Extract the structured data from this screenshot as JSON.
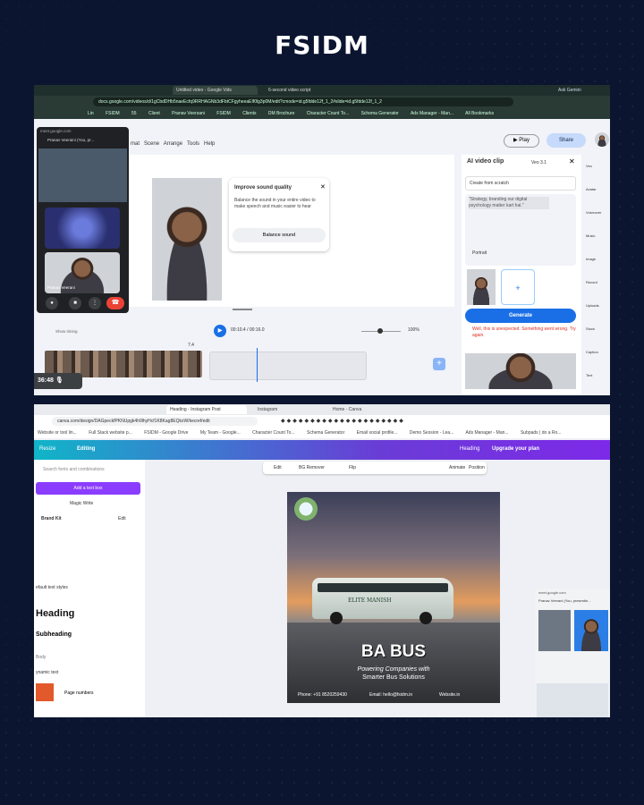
{
  "brand": "FSIDM",
  "top": {
    "tabs": [
      "Untitled video - Google Vids",
      "6-second video script"
    ],
    "url": "docs.google.com/videos/d/1gCbdDHb5naeEcfq9RRHAGNb3dFbtCFgyheeaEIf0lg3p0M/edit?cmode=id.g5fdde12f_1_2#slide=id.g5fdde12f_1_2",
    "ask_gemini": "Ask Gemini",
    "bookmarks": [
      "Lin",
      "FSIDM",
      "55",
      "Client",
      "Pranav Veersani",
      "FSIDM",
      "Clients",
      "DM Brochure",
      "Character Count To...",
      "Schema Generator",
      "Ads Manager - Man...",
      "All Bookmarks"
    ],
    "menu": [
      "mat",
      "Scene",
      "Arrange",
      "Tools",
      "Help"
    ],
    "play_label": "Play",
    "share_label": "Share",
    "meet_url": "meet.google.com",
    "meet_caller": "Pranav Veeraini (You, pr...",
    "meet_tile_name": "Pranav Veerani",
    "sound_title": "Improve sound quality",
    "sound_body": "Balance the sound in your entire video to make speech and music easier to hear",
    "sound_button": "Balance sound",
    "time": "00:10.4 / 00:16.0",
    "zoom": "100%",
    "show_timing": "Show timing",
    "marker": "7.4",
    "timer": "36:48",
    "panel_title": "AI video clip",
    "panel_model": "Veo 3.1",
    "panel_mode": "Create from scratch",
    "prompt": "\"Strategy, branding our digital psychology matter kart hai.\"",
    "orientation": "Portrait",
    "generate": "Generate",
    "error": "Well, this is unexpected. Something went wrong. Try again.",
    "sidebar": [
      "Veo",
      "Avatar",
      "Voiceover",
      "Music",
      "Image",
      "Record",
      "Uploads",
      "Stock",
      "Caption",
      "Text"
    ]
  },
  "bottom": {
    "tabs": [
      "Heading - Instagram Post",
      "Instagram",
      "Home - Canva"
    ],
    "url": "canva.com/design/DAGpeckfPKNUpgk4h9lhyHcf1K8Kag8EQkxW/kecref/edit",
    "bookmarks": [
      "Website or tool lin...",
      "Full Stack website p...",
      "FSIDM - Google Drive",
      "My Team - Google...",
      "Character Count To...",
      "Schema Generator",
      "Email social profile...",
      "Demo Session - Lea...",
      "Ads Manager - Man...",
      "Subpads | do a Ro..."
    ],
    "toolbar": {
      "resize": "Resize",
      "editing": "Editing",
      "heading": "Heading",
      "upgrade": "Upgrade your plan"
    },
    "search_placeholder": "Search fonts and combinations",
    "add_text": "Add a text box",
    "magic_write": "Magic Write",
    "brand_kit": "Brand Kit",
    "edit": "Edit",
    "default_styles": "efault text styles",
    "heading": "Heading",
    "subheading": "Subheading",
    "body": "Body",
    "dynamic_text": "ynamic text",
    "page_numbers": "Page numbers",
    "canvas_toolbar": [
      "Edit",
      "BG Remover",
      "Flip",
      "Animate",
      "Position"
    ],
    "bus_brand": "ELITE MANISH",
    "design_title": "BA BUS",
    "design_sub": "Powering Companies with",
    "design_sub2": "Smarter Bus Solutions",
    "phone": "Phone: +91 8520259430",
    "email": "Email: hello@fsidm.in",
    "website": "Website.in",
    "meet_url": "meet.google.com",
    "meet_caller": "Pranav Veerani (You, presentin..."
  },
  "colors": {
    "accent": "#1a6fe6",
    "canva": "#7d2ae8",
    "end": "#ea4335"
  }
}
